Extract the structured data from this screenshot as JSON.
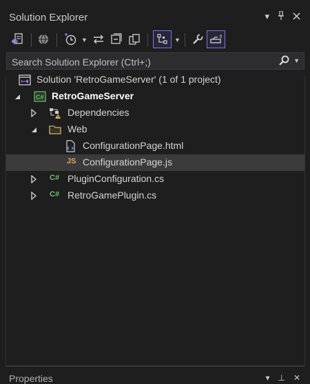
{
  "window": {
    "title": "Solution Explorer",
    "buttons": [
      "dropdown",
      "pin",
      "close"
    ]
  },
  "toolbar": {
    "items": [
      {
        "name": "switch-views",
        "icon": "vs-switch-views-icon"
      },
      {
        "name": "globe",
        "icon": "globe-icon"
      },
      {
        "name": "pending-changes",
        "icon": "clock-icon"
      },
      {
        "name": "sync",
        "icon": "sync-arrows-icon"
      },
      {
        "name": "collapse-all",
        "icon": "collapse-all-icon"
      },
      {
        "name": "show-all-files",
        "icon": "copy-files-icon"
      },
      {
        "name": "track-active",
        "icon": "hierarchy-icon",
        "active": true
      },
      {
        "name": "properties",
        "icon": "wrench-icon"
      },
      {
        "name": "preview-selected",
        "icon": "preview-icon",
        "active": true
      }
    ]
  },
  "search": {
    "placeholder": "Search Solution Explorer (Ctrl+;)"
  },
  "tree": {
    "solution": "Solution 'RetroGameServer' (1 of 1 project)",
    "project": "RetroGameServer",
    "items": [
      {
        "label": "Dependencies",
        "icon": "dependencies-warning-icon"
      },
      {
        "label": "Web",
        "icon": "folder-icon"
      },
      {
        "label": "ConfigurationPage.html",
        "icon": "html-file-icon"
      },
      {
        "label": "ConfigurationPage.js",
        "icon": "js-file-icon",
        "selected": true
      },
      {
        "label": "PluginConfiguration.cs",
        "icon": "csharp-file-icon"
      },
      {
        "label": "RetroGamePlugin.cs",
        "icon": "csharp-file-icon"
      }
    ]
  },
  "bottom_panel": {
    "title": "Properties"
  },
  "colors": {
    "background": "#1e1e1e",
    "accent": "#7b75e0",
    "selection": "#3b3b3b",
    "csharp": "#6dbf6d",
    "javascript": "#e2a55b"
  }
}
